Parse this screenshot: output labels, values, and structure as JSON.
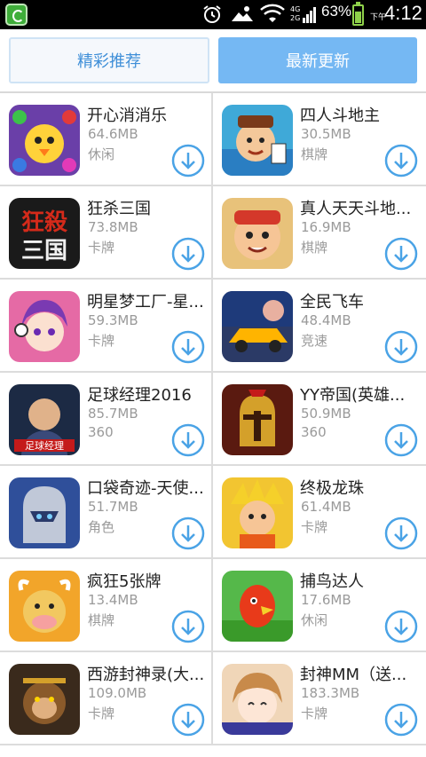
{
  "status_bar": {
    "network_top": "4G",
    "network_bottom": "2G",
    "battery": "63%",
    "ampm": "下午",
    "time": "4:12",
    "battery_level": 0.63
  },
  "tabs": {
    "left_label": "精彩推荐",
    "right_label": "最新更新"
  },
  "apps": [
    {
      "name": "开心消消乐",
      "size": "64.6MB",
      "category": "休闲",
      "icon": "candy-chick-icon",
      "icon_bg": "#6a3fa8"
    },
    {
      "name": "四人斗地主",
      "size": "30.5MB",
      "category": "棋牌",
      "icon": "poker-boy-icon",
      "icon_bg": "#3fa9d8"
    },
    {
      "name": "狂杀三国",
      "size": "73.8MB",
      "category": "卡牌",
      "icon": "three-kingdoms-icon",
      "icon_bg": "#1a1a1a"
    },
    {
      "name": "真人天天斗地...",
      "size": "16.9MB",
      "category": "棋牌",
      "icon": "peasant-boy-icon",
      "icon_bg": "#e8c27a"
    },
    {
      "name": "明星梦工厂-星...",
      "size": "59.3MB",
      "category": "卡牌",
      "icon": "anime-girl-icon",
      "icon_bg": "#e56aa5"
    },
    {
      "name": "全民飞车",
      "size": "48.4MB",
      "category": "竞速",
      "icon": "race-car-icon",
      "icon_bg": "#2b3a66"
    },
    {
      "name": "足球经理2016",
      "size": "85.7MB",
      "category": "360",
      "icon": "football-player-icon",
      "icon_bg": "#1c2a44"
    },
    {
      "name": "YY帝国(英雄...",
      "size": "50.9MB",
      "category": "360",
      "icon": "spartan-helmet-icon",
      "icon_bg": "#5a1a10"
    },
    {
      "name": "口袋奇迹-天使...",
      "size": "51.7MB",
      "category": "角色",
      "icon": "knight-icon",
      "icon_bg": "#2f4f9a"
    },
    {
      "name": "终极龙珠",
      "size": "61.4MB",
      "category": "卡牌",
      "icon": "dragon-warrior-icon",
      "icon_bg": "#f2c531"
    },
    {
      "name": "疯狂5张牌",
      "size": "13.4MB",
      "category": "棋牌",
      "icon": "bull-icon",
      "icon_bg": "#f2a52a"
    },
    {
      "name": "捕鸟达人",
      "size": "17.6MB",
      "category": "休闲",
      "icon": "parrot-icon",
      "icon_bg": "#55b84a"
    },
    {
      "name": "西游封神录(大...",
      "size": "109.0MB",
      "category": "卡牌",
      "icon": "monkey-king-icon",
      "icon_bg": "#3a2a1c"
    },
    {
      "name": "封神MM（送...",
      "size": "183.3MB",
      "category": "卡牌",
      "icon": "cute-girl-icon",
      "icon_bg": "#f0d6b8"
    }
  ],
  "colors": {
    "accent": "#3f8fd8",
    "tab_active": "#75b8f3",
    "download_ring": "#4aa3e6"
  }
}
